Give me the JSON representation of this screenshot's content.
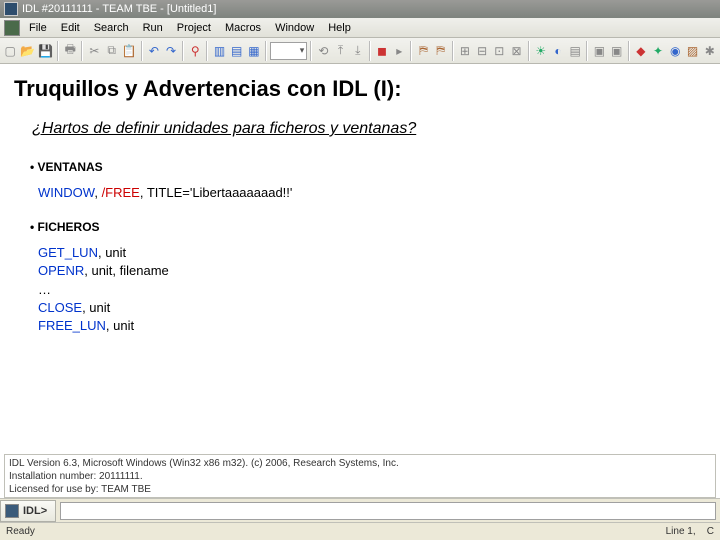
{
  "window": {
    "title": "IDL #20111111 - TEAM TBE - [Untitled1]"
  },
  "menu": {
    "items": [
      "File",
      "Edit",
      "Search",
      "Run",
      "Project",
      "Macros",
      "Window",
      "Help"
    ]
  },
  "toolbar": {
    "combo_value": ""
  },
  "content": {
    "heading": "Truquillos y Advertencias con IDL (I):",
    "subhead": "¿Hartos de definir unidades para ficheros y ventanas?",
    "section1": "VENTANAS",
    "code1": {
      "window": "WINDOW",
      "free": "/FREE",
      "tail": ", TITLE='Libertaaaaaaad!!'",
      "sep": ", "
    },
    "section2": "FICHEROS",
    "code2": {
      "getlun": "GET_LUN",
      "openr": "OPENR",
      "close": "CLOSE",
      "freelun": "FREE_LUN",
      "unit": ", unit",
      "unitfile": ", unit, filename",
      "dots": "…"
    }
  },
  "output": {
    "line1": "IDL Version 6.3, Microsoft Windows (Win32 x86 m32). (c) 2006, Research Systems, Inc.",
    "line2": "Installation number: 20111111.",
    "line3": "Licensed for use by: TEAM TBE"
  },
  "prompt": {
    "label": "IDL>"
  },
  "status": {
    "left": "Ready",
    "right_line": "Line 1,",
    "right_col": "C"
  }
}
